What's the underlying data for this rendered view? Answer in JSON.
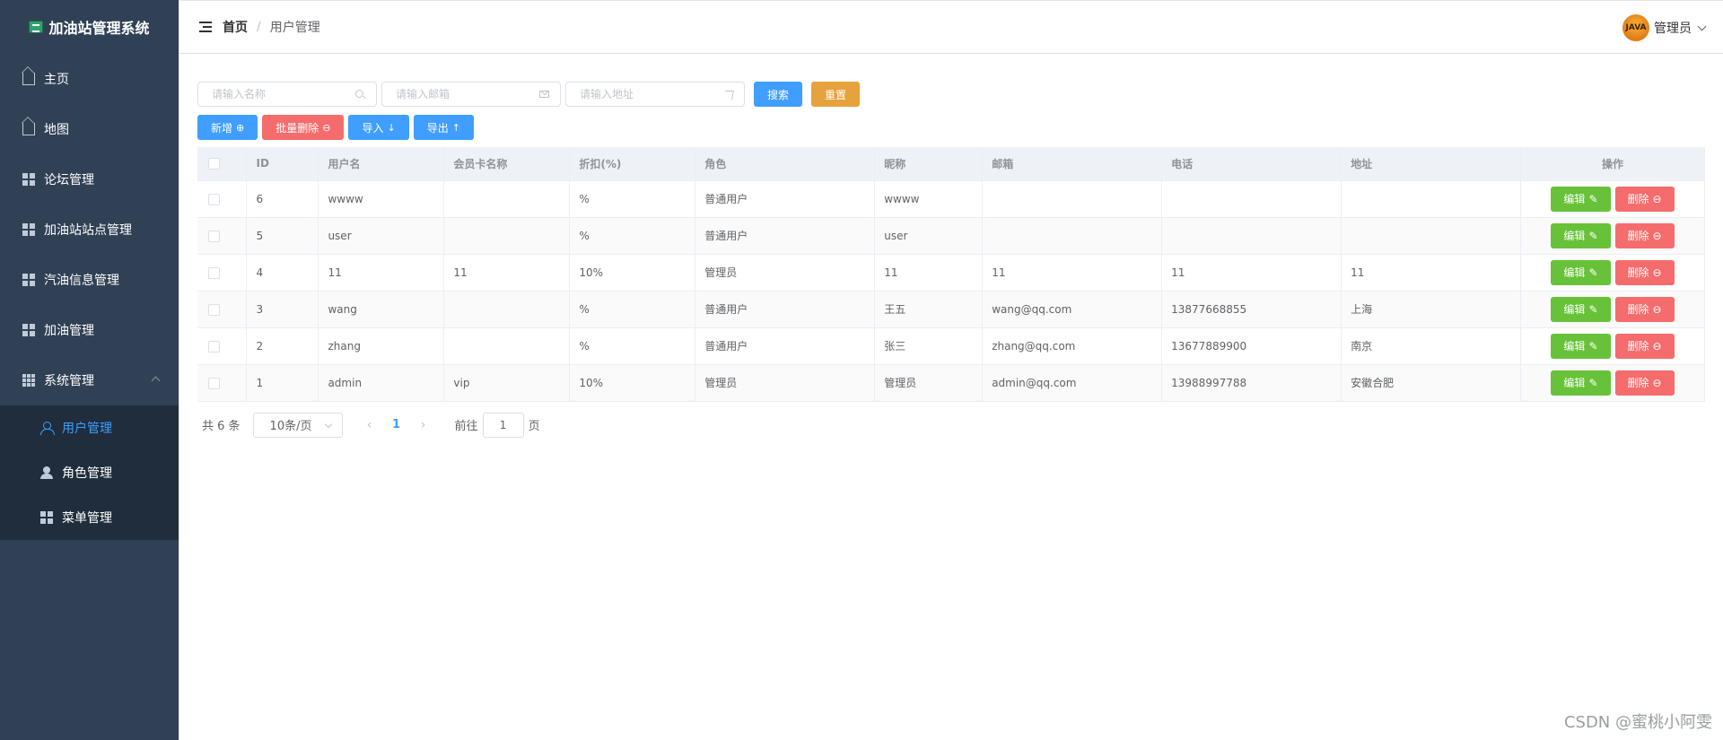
{
  "app": {
    "title": "加油站管理系统"
  },
  "sidebar": {
    "items": [
      {
        "label": "主页",
        "icon": "home-icon"
      },
      {
        "label": "地图",
        "icon": "home-icon"
      },
      {
        "label": "论坛管理",
        "icon": "grid-icon"
      },
      {
        "label": "加油站站点管理",
        "icon": "grid-icon"
      },
      {
        "label": "汽油信息管理",
        "icon": "grid-icon"
      },
      {
        "label": "加油管理",
        "icon": "grid-icon"
      },
      {
        "label": "系统管理",
        "icon": "grid9-icon"
      }
    ],
    "sub_items": [
      {
        "label": "用户管理",
        "icon": "user-icon",
        "active": true
      },
      {
        "label": "角色管理",
        "icon": "role-icon"
      },
      {
        "label": "菜单管理",
        "icon": "grid-icon"
      }
    ]
  },
  "header": {
    "breadcrumb": {
      "home": "首页",
      "separator": "/",
      "current": "用户管理"
    },
    "user": {
      "name": "管理员",
      "avatar_text": "JAVA"
    }
  },
  "search": {
    "name_placeholder": "请输入名称",
    "email_placeholder": "请输入邮箱",
    "address_placeholder": "请输入地址",
    "search_label": "搜索",
    "reset_label": "重置"
  },
  "actions": {
    "add_label": "新增",
    "batch_delete_label": "批量删除",
    "import_label": "导入",
    "export_label": "导出"
  },
  "table": {
    "columns": [
      "ID",
      "用户名",
      "会员卡名称",
      "折扣(%)",
      "角色",
      "昵称",
      "邮箱",
      "电话",
      "地址",
      "操作"
    ],
    "edit_label": "编辑",
    "delete_label": "删除",
    "rows": [
      {
        "id": "6",
        "username": "wwww",
        "card": "",
        "discount": "%",
        "role": "普通用户",
        "nickname": "wwww",
        "email": "",
        "phone": "",
        "address": ""
      },
      {
        "id": "5",
        "username": "user",
        "card": "",
        "discount": "%",
        "role": "普通用户",
        "nickname": "user",
        "email": "",
        "phone": "",
        "address": ""
      },
      {
        "id": "4",
        "username": "11",
        "card": "11",
        "discount": "10%",
        "role": "管理员",
        "nickname": "11",
        "email": "11",
        "phone": "11",
        "address": "11"
      },
      {
        "id": "3",
        "username": "wang",
        "card": "",
        "discount": "%",
        "role": "普通用户",
        "nickname": "王五",
        "email": "wang@qq.com",
        "phone": "13877668855",
        "address": "上海"
      },
      {
        "id": "2",
        "username": "zhang",
        "card": "",
        "discount": "%",
        "role": "普通用户",
        "nickname": "张三",
        "email": "zhang@qq.com",
        "phone": "13677889900",
        "address": "南京"
      },
      {
        "id": "1",
        "username": "admin",
        "card": "vip",
        "discount": "10%",
        "role": "管理员",
        "nickname": "管理员",
        "email": "admin@qq.com",
        "phone": "13988997788",
        "address": "安徽合肥"
      }
    ]
  },
  "pagination": {
    "total_text": "共 6 条",
    "page_size": "10条/页",
    "current_page": "1",
    "goto_prefix": "前往",
    "goto_value": "1",
    "goto_suffix": "页"
  },
  "watermark": "CSDN @蜜桃小阿雯"
}
